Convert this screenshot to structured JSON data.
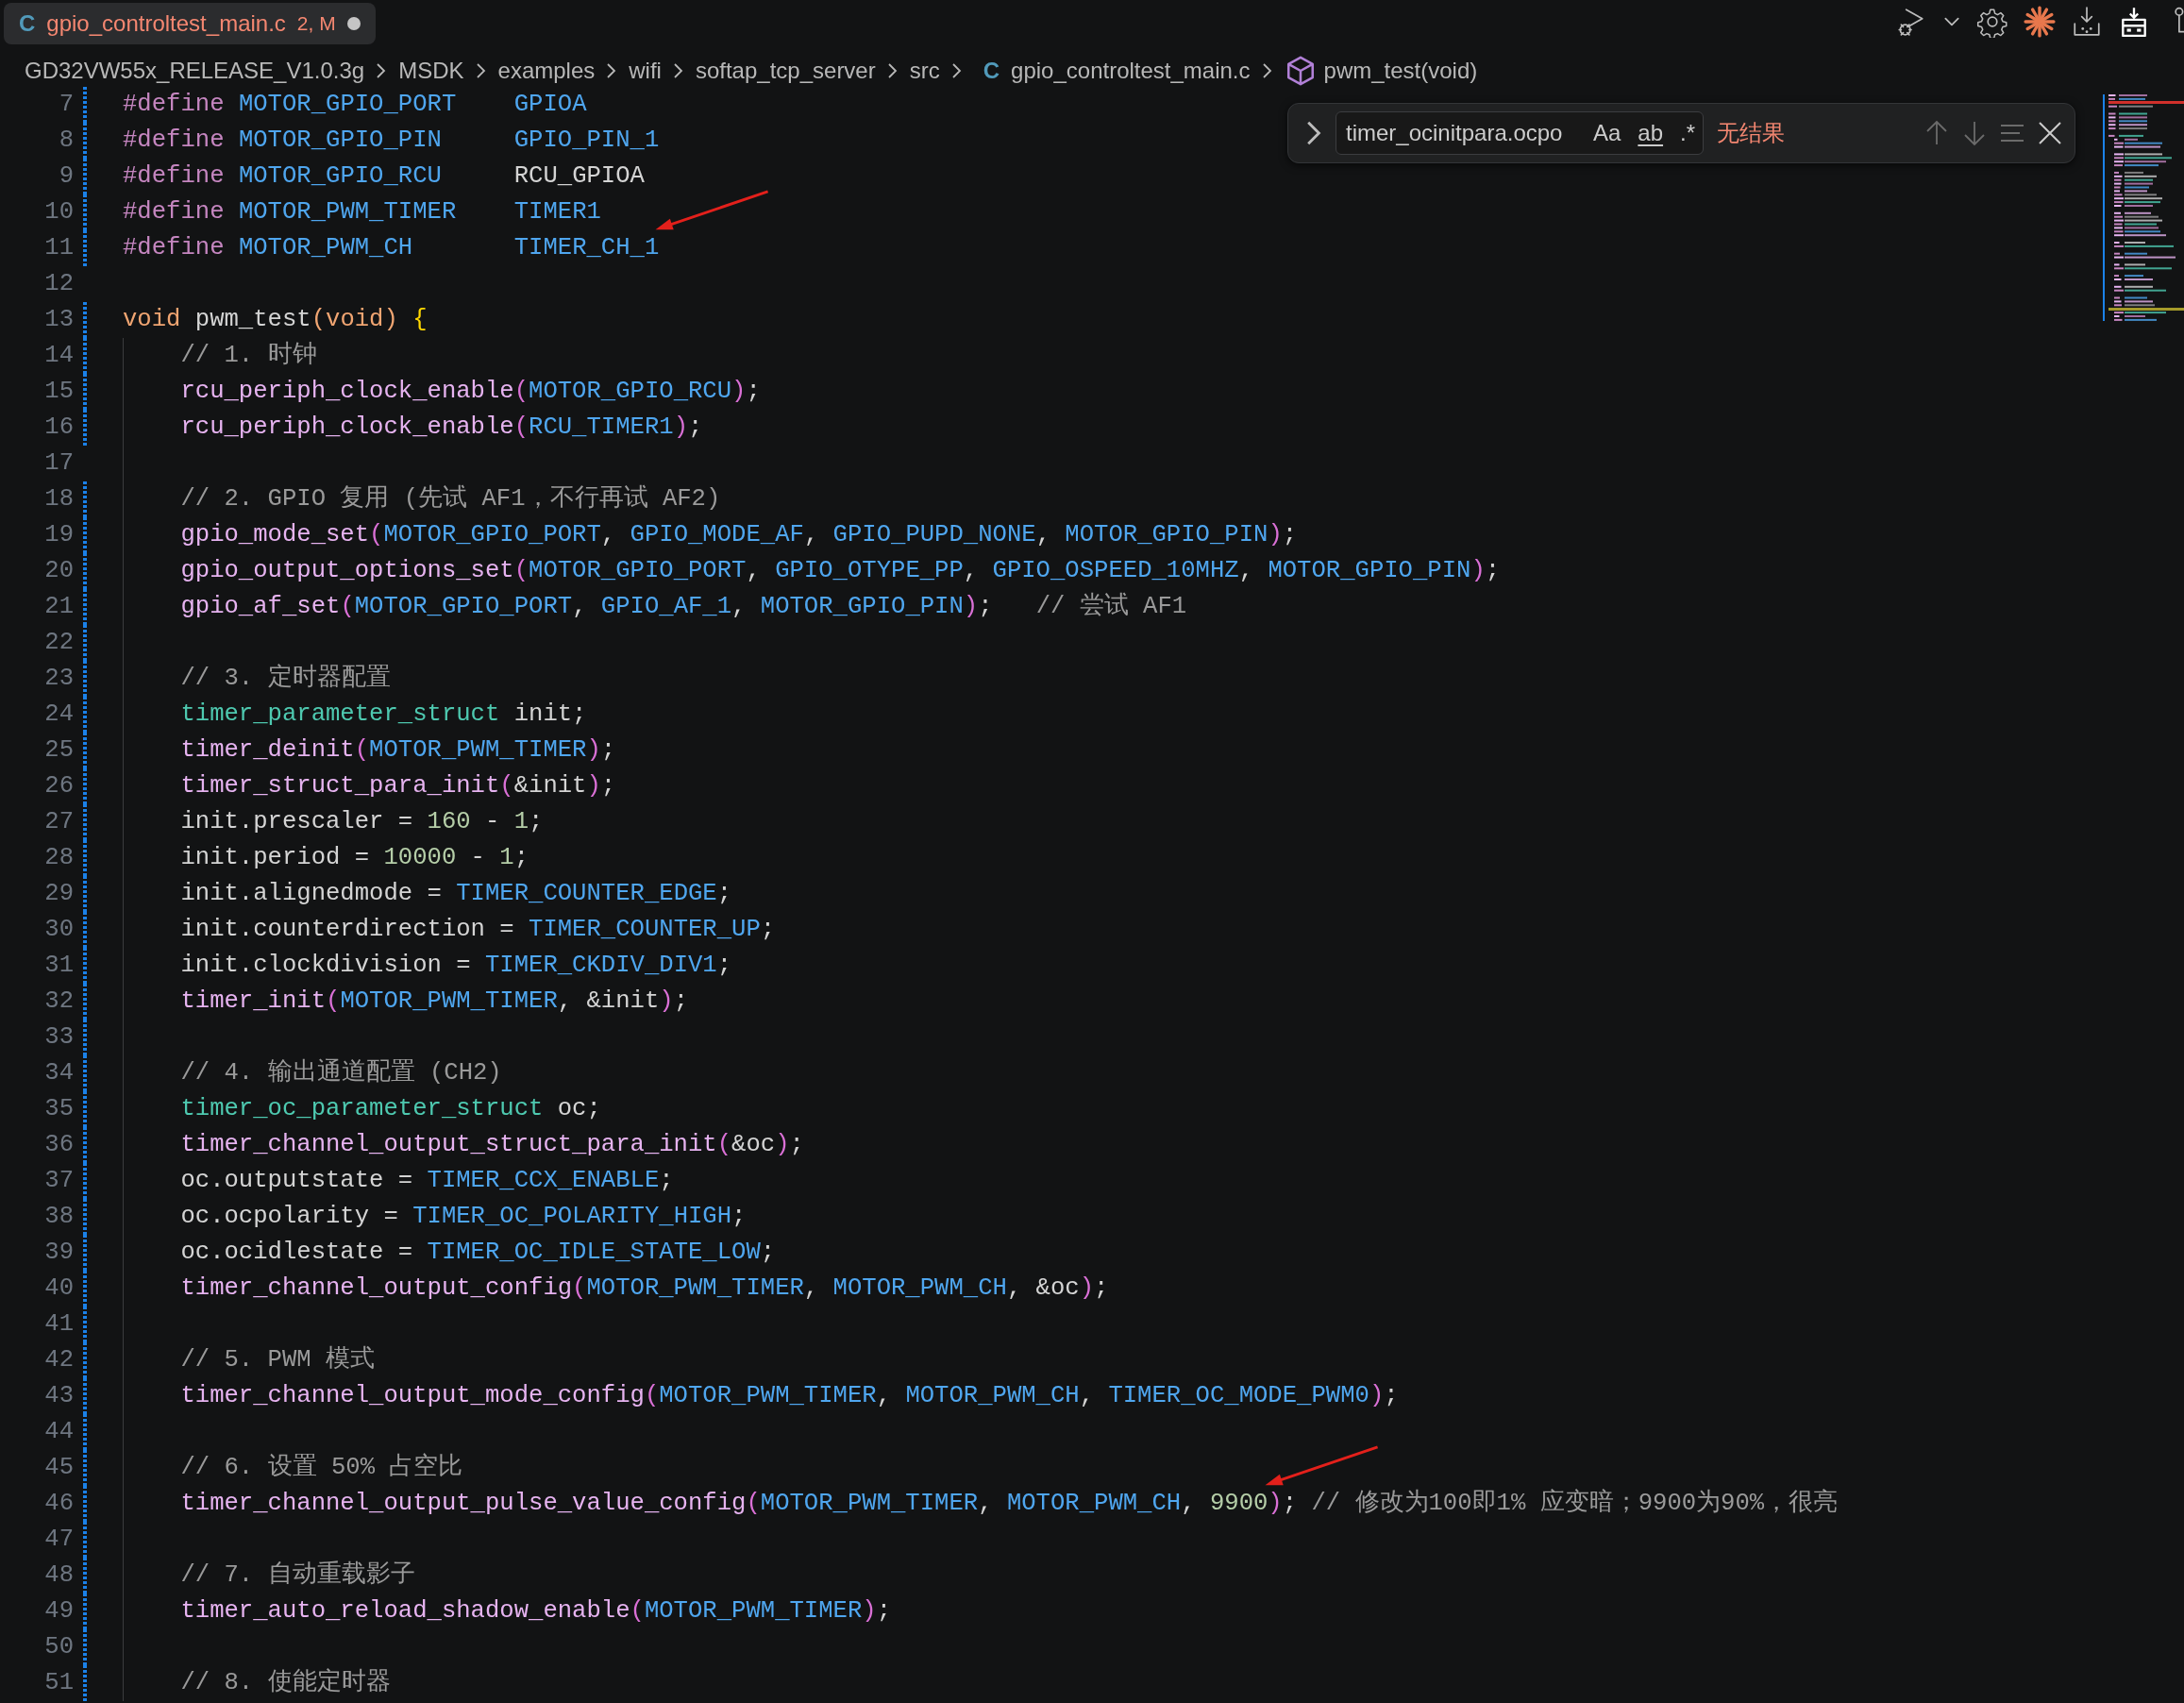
{
  "tab": {
    "file_icon": "C",
    "label": "gpio_controltest_main.c",
    "badge": "2, M",
    "dirty": true
  },
  "breadcrumbs": [
    {
      "kind": "folder",
      "label": "GD32VW55x_RELEASE_V1.0.3g"
    },
    {
      "kind": "folder",
      "label": "MSDK"
    },
    {
      "kind": "folder",
      "label": "examples"
    },
    {
      "kind": "folder",
      "label": "wifi"
    },
    {
      "kind": "folder",
      "label": "softap_tcp_server"
    },
    {
      "kind": "folder",
      "label": "src"
    },
    {
      "kind": "file",
      "file_icon": "C",
      "label": "gpio_controltest_main.c"
    },
    {
      "kind": "symbol",
      "label": "pwm_test(void)"
    }
  ],
  "find_widget": {
    "value": "timer_ocinitpara.ocpo",
    "toggles": [
      {
        "kind": "case",
        "label": "Aa"
      },
      {
        "kind": "word",
        "label": "ab"
      },
      {
        "kind": "regex",
        "label": ".*"
      }
    ],
    "result": "无结果"
  },
  "lines": [
    {
      "number": "7",
      "modified": true,
      "tokens": [
        {
          "kind": "pp",
          "text": "#define "
        },
        {
          "kind": "macro",
          "text": "MOTOR_GPIO_PORT"
        },
        {
          "kind": "macro",
          "text": "    GPIOA"
        }
      ]
    },
    {
      "number": "8",
      "modified": true,
      "tokens": [
        {
          "kind": "pp",
          "text": "#define "
        },
        {
          "kind": "macro",
          "text": "MOTOR_GPIO_PIN"
        },
        {
          "kind": "macro",
          "text": "     GPIO_PIN_1"
        }
      ]
    },
    {
      "number": "9",
      "modified": true,
      "tokens": [
        {
          "kind": "pp",
          "text": "#define "
        },
        {
          "kind": "macro",
          "text": "MOTOR_GPIO_RCU"
        },
        {
          "kind": "text",
          "text": "     RCU_GPIOA"
        }
      ]
    },
    {
      "number": "10",
      "modified": true,
      "tokens": [
        {
          "kind": "pp",
          "text": "#define "
        },
        {
          "kind": "macro",
          "text": "MOTOR_PWM_TIMER"
        },
        {
          "kind": "macro",
          "text": "    TIMER1"
        }
      ]
    },
    {
      "number": "11",
      "modified": true,
      "tokens": [
        {
          "kind": "pp",
          "text": "#define "
        },
        {
          "kind": "macro",
          "text": "MOTOR_PWM_CH"
        },
        {
          "kind": "macro",
          "text": "       TIMER_CH_1",
          "arrow": true
        }
      ]
    },
    {
      "number": "12",
      "modified": false
    },
    {
      "number": "13",
      "modified": true,
      "tokens": [
        {
          "kind": "kw",
          "text": "void"
        },
        {
          "kind": "text",
          "text": " pwm_test"
        },
        {
          "kind": "kw",
          "text": "(void)"
        },
        {
          "kind": "brace",
          "text": " {"
        }
      ],
      "children": [
        {
          "number": "14",
          "modified": true,
          "tokens": [
            {
              "kind": "comment",
              "text": "// 1. 时钟"
            }
          ]
        },
        {
          "number": "15",
          "modified": true,
          "tokens": [
            {
              "kind": "fn",
              "text": "rcu_periph_clock_enable"
            },
            {
              "kind": "paren",
              "text": "("
            },
            {
              "kind": "macro",
              "text": "MOTOR_GPIO_RCU"
            },
            {
              "kind": "paren",
              "text": ")"
            },
            {
              "kind": "text",
              "text": ";"
            }
          ]
        },
        {
          "number": "16",
          "modified": true,
          "tokens": [
            {
              "kind": "fn",
              "text": "rcu_periph_clock_enable"
            },
            {
              "kind": "paren",
              "text": "("
            },
            {
              "kind": "macro",
              "text": "RCU_TIMER1"
            },
            {
              "kind": "paren",
              "text": ")"
            },
            {
              "kind": "text",
              "text": ";"
            }
          ]
        },
        {
          "number": "17",
          "modified": false
        },
        {
          "number": "18",
          "modified": true,
          "tokens": [
            {
              "kind": "comment",
              "text": "// 2. GPIO 复用 (先试 AF1，不行再试 AF2)"
            }
          ]
        },
        {
          "number": "19",
          "modified": true,
          "tokens": [
            {
              "kind": "fn",
              "text": "gpio_mode_set"
            },
            {
              "kind": "paren",
              "text": "("
            },
            {
              "kind": "macro",
              "text": "MOTOR_GPIO_PORT"
            },
            {
              "kind": "text",
              "text": ", "
            },
            {
              "kind": "macro",
              "text": "GPIO_MODE_AF"
            },
            {
              "kind": "text",
              "text": ", "
            },
            {
              "kind": "macro",
              "text": "GPIO_PUPD_NONE"
            },
            {
              "kind": "text",
              "text": ", "
            },
            {
              "kind": "macro",
              "text": "MOTOR_GPIO_PIN"
            },
            {
              "kind": "paren",
              "text": ")"
            },
            {
              "kind": "text",
              "text": ";"
            }
          ]
        },
        {
          "number": "20",
          "modified": true,
          "tokens": [
            {
              "kind": "fn",
              "text": "gpio_output_options_set"
            },
            {
              "kind": "paren",
              "text": "("
            },
            {
              "kind": "macro",
              "text": "MOTOR_GPIO_PORT"
            },
            {
              "kind": "text",
              "text": ", "
            },
            {
              "kind": "macro",
              "text": "GPIO_OTYPE_PP"
            },
            {
              "kind": "text",
              "text": ", "
            },
            {
              "kind": "macro",
              "text": "GPIO_OSPEED_10MHZ"
            },
            {
              "kind": "text",
              "text": ", "
            },
            {
              "kind": "macro",
              "text": "MOTOR_GPIO_PIN"
            },
            {
              "kind": "paren",
              "text": ")"
            },
            {
              "kind": "text",
              "text": ";"
            }
          ]
        },
        {
          "number": "21",
          "modified": true,
          "tokens": [
            {
              "kind": "fn",
              "text": "gpio_af_set"
            },
            {
              "kind": "paren",
              "text": "("
            },
            {
              "kind": "macro",
              "text": "MOTOR_GPIO_PORT"
            },
            {
              "kind": "text",
              "text": ", "
            },
            {
              "kind": "macro",
              "text": "GPIO_AF_1"
            },
            {
              "kind": "text",
              "text": ", "
            },
            {
              "kind": "macro",
              "text": "MOTOR_GPIO_PIN"
            },
            {
              "kind": "paren",
              "text": ")"
            },
            {
              "kind": "text",
              "text": ";   "
            },
            {
              "kind": "comment",
              "text": "// 尝试 AF1"
            }
          ]
        },
        {
          "number": "22",
          "modified": true
        },
        {
          "number": "23",
          "modified": true,
          "tokens": [
            {
              "kind": "comment",
              "text": "// 3. 定时器配置"
            }
          ]
        },
        {
          "number": "24",
          "modified": true,
          "tokens": [
            {
              "kind": "type",
              "text": "timer_parameter_struct"
            },
            {
              "kind": "text",
              "text": " init;"
            }
          ]
        },
        {
          "number": "25",
          "modified": true,
          "tokens": [
            {
              "kind": "fn",
              "text": "timer_deinit"
            },
            {
              "kind": "paren",
              "text": "("
            },
            {
              "kind": "macro",
              "text": "MOTOR_PWM_TIMER"
            },
            {
              "kind": "paren",
              "text": ")"
            },
            {
              "kind": "text",
              "text": ";"
            }
          ]
        },
        {
          "number": "26",
          "modified": true,
          "tokens": [
            {
              "kind": "fn",
              "text": "timer_struct_para_init"
            },
            {
              "kind": "paren",
              "text": "("
            },
            {
              "kind": "text",
              "text": "&init"
            },
            {
              "kind": "paren",
              "text": ")"
            },
            {
              "kind": "text",
              "text": ";"
            }
          ]
        },
        {
          "number": "27",
          "modified": true,
          "tokens": [
            {
              "kind": "text",
              "text": "init.prescaler = "
            },
            {
              "kind": "num",
              "text": "160"
            },
            {
              "kind": "text",
              "text": " - "
            },
            {
              "kind": "num",
              "text": "1"
            },
            {
              "kind": "text",
              "text": ";"
            }
          ]
        },
        {
          "number": "28",
          "modified": true,
          "tokens": [
            {
              "kind": "text",
              "text": "init.period = "
            },
            {
              "kind": "num",
              "text": "10000"
            },
            {
              "kind": "text",
              "text": " - "
            },
            {
              "kind": "num",
              "text": "1"
            },
            {
              "kind": "text",
              "text": ";"
            }
          ]
        },
        {
          "number": "29",
          "modified": true,
          "tokens": [
            {
              "kind": "text",
              "text": "init.alignedmode = "
            },
            {
              "kind": "macro",
              "text": "TIMER_COUNTER_EDGE"
            },
            {
              "kind": "text",
              "text": ";"
            }
          ]
        },
        {
          "number": "30",
          "modified": true,
          "tokens": [
            {
              "kind": "text",
              "text": "init.counterdirection = "
            },
            {
              "kind": "macro",
              "text": "TIMER_COUNTER_UP"
            },
            {
              "kind": "text",
              "text": ";"
            }
          ]
        },
        {
          "number": "31",
          "modified": true,
          "tokens": [
            {
              "kind": "text",
              "text": "init.clockdivision = "
            },
            {
              "kind": "macro",
              "text": "TIMER_CKDIV_DIV1"
            },
            {
              "kind": "text",
              "text": ";"
            }
          ]
        },
        {
          "number": "32",
          "modified": true,
          "tokens": [
            {
              "kind": "fn",
              "text": "timer_init"
            },
            {
              "kind": "paren",
              "text": "("
            },
            {
              "kind": "macro",
              "text": "MOTOR_PWM_TIMER"
            },
            {
              "kind": "text",
              "text": ", &init"
            },
            {
              "kind": "paren",
              "text": ")"
            },
            {
              "kind": "text",
              "text": ";"
            }
          ]
        },
        {
          "number": "33",
          "modified": true
        },
        {
          "number": "34",
          "modified": true,
          "tokens": [
            {
              "kind": "comment",
              "text": "// 4. 输出通道配置 (CH2)"
            }
          ]
        },
        {
          "number": "35",
          "modified": true,
          "tokens": [
            {
              "kind": "type",
              "text": "timer_oc_parameter_struct"
            },
            {
              "kind": "text",
              "text": " oc;"
            }
          ]
        },
        {
          "number": "36",
          "modified": true,
          "tokens": [
            {
              "kind": "fn",
              "text": "timer_channel_output_struct_para_init"
            },
            {
              "kind": "paren",
              "text": "("
            },
            {
              "kind": "text",
              "text": "&oc"
            },
            {
              "kind": "paren",
              "text": ")"
            },
            {
              "kind": "text",
              "text": ";"
            }
          ]
        },
        {
          "number": "37",
          "modified": true,
          "tokens": [
            {
              "kind": "text",
              "text": "oc.outputstate = "
            },
            {
              "kind": "macro",
              "text": "TIMER_CCX_ENABLE"
            },
            {
              "kind": "text",
              "text": ";"
            }
          ]
        },
        {
          "number": "38",
          "modified": true,
          "tokens": [
            {
              "kind": "text",
              "text": "oc.ocpolarity = "
            },
            {
              "kind": "macro",
              "text": "TIMER_OC_POLARITY_HIGH"
            },
            {
              "kind": "text",
              "text": ";"
            }
          ]
        },
        {
          "number": "39",
          "modified": true,
          "tokens": [
            {
              "kind": "text",
              "text": "oc.ocidlestate = "
            },
            {
              "kind": "macro",
              "text": "TIMER_OC_IDLE_STATE_LOW"
            },
            {
              "kind": "text",
              "text": ";"
            }
          ]
        },
        {
          "number": "40",
          "modified": true,
          "tokens": [
            {
              "kind": "fn",
              "text": "timer_channel_output_config"
            },
            {
              "kind": "paren",
              "text": "("
            },
            {
              "kind": "macro",
              "text": "MOTOR_PWM_TIMER"
            },
            {
              "kind": "text",
              "text": ", "
            },
            {
              "kind": "macro",
              "text": "MOTOR_PWM_CH"
            },
            {
              "kind": "text",
              "text": ", &oc"
            },
            {
              "kind": "paren",
              "text": ")"
            },
            {
              "kind": "text",
              "text": ";"
            }
          ]
        },
        {
          "number": "41",
          "modified": true
        },
        {
          "number": "42",
          "modified": true,
          "tokens": [
            {
              "kind": "comment",
              "text": "// 5. PWM 模式"
            }
          ]
        },
        {
          "number": "43",
          "modified": true,
          "tokens": [
            {
              "kind": "fn",
              "text": "timer_channel_output_mode_config"
            },
            {
              "kind": "paren",
              "text": "("
            },
            {
              "kind": "macro",
              "text": "MOTOR_PWM_TIMER"
            },
            {
              "kind": "text",
              "text": ", "
            },
            {
              "kind": "macro",
              "text": "MOTOR_PWM_CH"
            },
            {
              "kind": "text",
              "text": ", "
            },
            {
              "kind": "macro",
              "text": "TIMER_OC_MODE_PWM0"
            },
            {
              "kind": "paren",
              "text": ")"
            },
            {
              "kind": "text",
              "text": ";"
            }
          ]
        },
        {
          "number": "44",
          "modified": true
        },
        {
          "number": "45",
          "modified": true,
          "tokens": [
            {
              "kind": "comment",
              "text": "// 6. 设置 50% 占空比"
            }
          ]
        },
        {
          "number": "46",
          "modified": true,
          "tokens": [
            {
              "kind": "fn",
              "text": "timer_channel_output_pulse_value_config"
            },
            {
              "kind": "paren",
              "text": "("
            },
            {
              "kind": "macro",
              "text": "MOTOR_PWM_TIMER"
            },
            {
              "kind": "text",
              "text": ", "
            },
            {
              "kind": "macro",
              "text": "MOTOR_PWM_CH"
            },
            {
              "kind": "text",
              "text": ", "
            },
            {
              "kind": "num",
              "text": "9900",
              "arrow": true
            },
            {
              "kind": "paren",
              "text": ")"
            },
            {
              "kind": "text",
              "text": "; "
            },
            {
              "kind": "comment",
              "text": "// 修改为100即1% 应变暗；9900为90%，很亮"
            }
          ]
        },
        {
          "number": "47",
          "modified": true
        },
        {
          "number": "48",
          "modified": true,
          "tokens": [
            {
              "kind": "comment",
              "text": "// 7. 自动重载影子"
            }
          ]
        },
        {
          "number": "49",
          "modified": true,
          "tokens": [
            {
              "kind": "fn",
              "text": "timer_auto_reload_shadow_enable"
            },
            {
              "kind": "paren",
              "text": "("
            },
            {
              "kind": "macro",
              "text": "MOTOR_PWM_TIMER"
            },
            {
              "kind": "paren",
              "text": ")"
            },
            {
              "kind": "text",
              "text": ";"
            }
          ]
        },
        {
          "number": "50",
          "modified": true
        },
        {
          "number": "51",
          "modified": true,
          "tokens": [
            {
              "kind": "comment",
              "text": "// 8. 使能定时器"
            }
          ]
        }
      ]
    }
  ]
}
